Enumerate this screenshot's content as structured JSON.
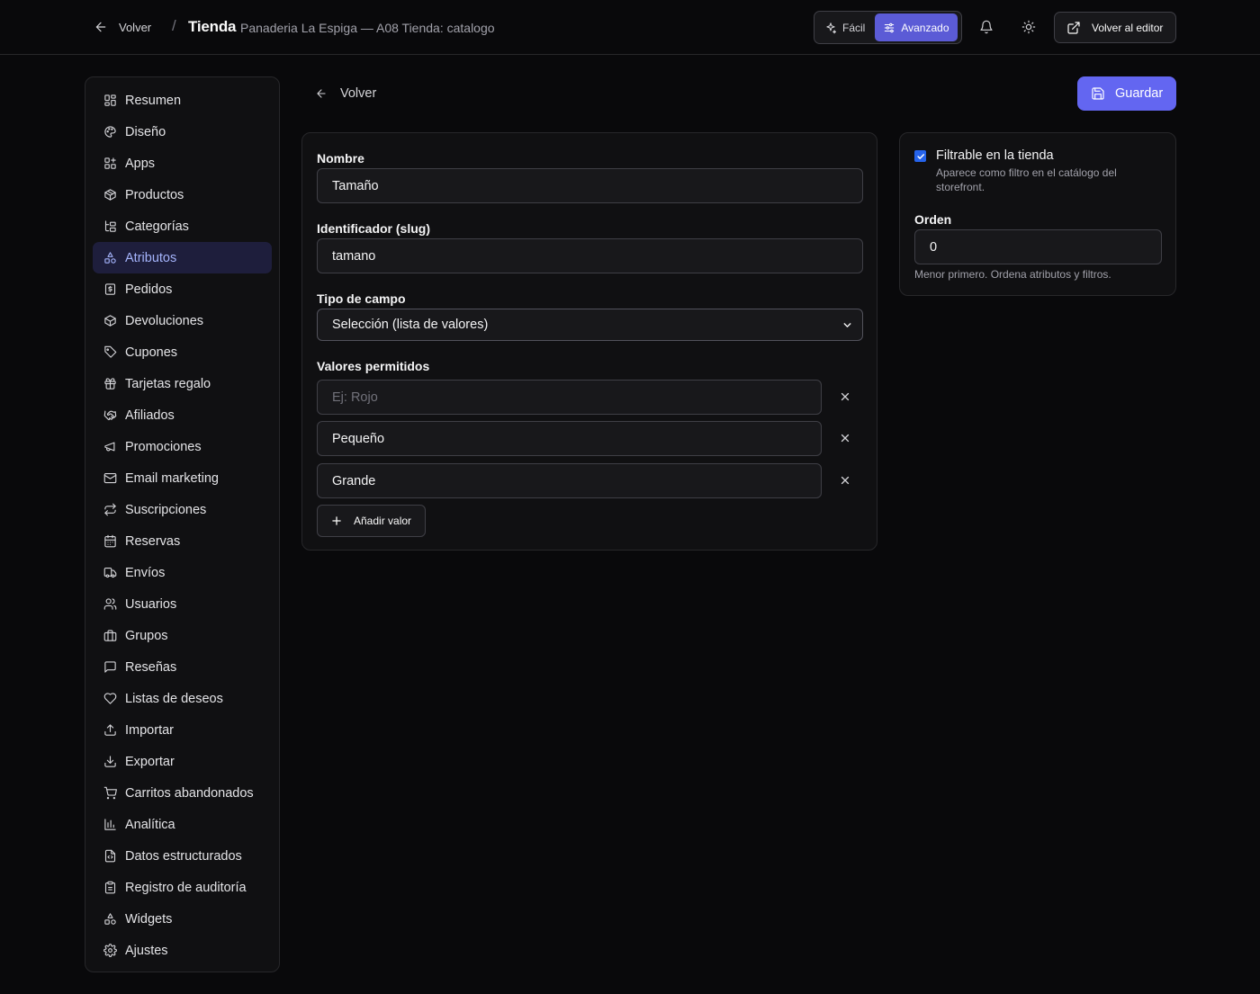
{
  "topbar": {
    "back_label": "Volver",
    "separator": "/",
    "title": "Tienda",
    "subtitle": "Panaderia La Espiga — A08 Tienda: catalogo",
    "mode_easy": "Fácil",
    "mode_advanced": "Avanzado",
    "editor_label": "Volver al editor"
  },
  "sidebar": {
    "items": [
      {
        "label": "Resumen",
        "icon": "dashboard-icon"
      },
      {
        "label": "Diseño",
        "icon": "palette-icon"
      },
      {
        "label": "Apps",
        "icon": "apps-icon"
      },
      {
        "label": "Productos",
        "icon": "package-icon"
      },
      {
        "label": "Categorías",
        "icon": "folder-tree-icon"
      },
      {
        "label": "Atributos",
        "icon": "shapes-icon"
      },
      {
        "label": "Pedidos",
        "icon": "receipt-icon"
      },
      {
        "label": "Devoluciones",
        "icon": "package-return-icon"
      },
      {
        "label": "Cupones",
        "icon": "tag-icon"
      },
      {
        "label": "Tarjetas regalo",
        "icon": "gift-icon"
      },
      {
        "label": "Afiliados",
        "icon": "handshake-icon"
      },
      {
        "label": "Promociones",
        "icon": "megaphone-icon"
      },
      {
        "label": "Email marketing",
        "icon": "mail-icon"
      },
      {
        "label": "Suscripciones",
        "icon": "repeat-icon"
      },
      {
        "label": "Reservas",
        "icon": "calendar-icon"
      },
      {
        "label": "Envíos",
        "icon": "truck-icon"
      },
      {
        "label": "Usuarios",
        "icon": "users-icon"
      },
      {
        "label": "Grupos",
        "icon": "briefcase-icon"
      },
      {
        "label": "Reseñas",
        "icon": "message-icon"
      },
      {
        "label": "Listas de deseos",
        "icon": "heart-icon"
      },
      {
        "label": "Importar",
        "icon": "upload-icon"
      },
      {
        "label": "Exportar",
        "icon": "download-icon"
      },
      {
        "label": "Carritos abandonados",
        "icon": "cart-icon"
      },
      {
        "label": "Analítica",
        "icon": "bar-chart-icon"
      },
      {
        "label": "Datos estructurados",
        "icon": "file-code-icon"
      },
      {
        "label": "Registro de auditoría",
        "icon": "clipboard-icon"
      },
      {
        "label": "Widgets",
        "icon": "widgets-icon"
      },
      {
        "label": "Ajustes",
        "icon": "gear-icon"
      }
    ],
    "active_label": "Atributos"
  },
  "content": {
    "back_label": "Volver",
    "save_label": "Guardar"
  },
  "form": {
    "name_label": "Nombre",
    "name_value": "Tamaño",
    "slug_label": "Identificador (slug)",
    "slug_value": "tamano",
    "type_label": "Tipo de campo",
    "type_value": "Selección (lista de valores)",
    "values_label": "Valores permitidos",
    "value_placeholder": "Ej: Rojo",
    "values": [
      "",
      "Pequeño",
      "Grande"
    ],
    "add_value_label": "Añadir valor"
  },
  "side": {
    "filterable_label": "Filtrable en la tienda",
    "filterable_checked": true,
    "filterable_desc": "Aparece como filtro en el catálogo del storefront.",
    "order_label": "Orden",
    "order_value": "0",
    "order_help": "Menor primero. Ordena atributos y filtros."
  },
  "colors": {
    "accent": "#6366f1",
    "active_mode": "#5b5bd6",
    "background": "#09090b"
  }
}
